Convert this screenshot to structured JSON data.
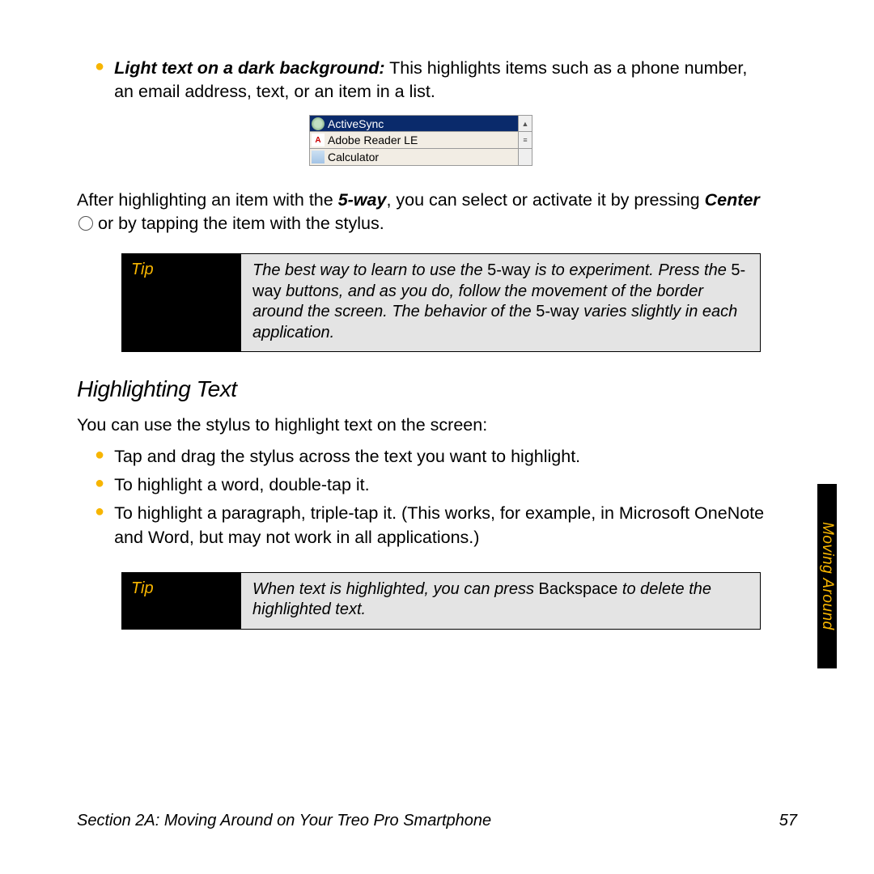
{
  "intro_bullet": {
    "lead_bold": "Light text on a dark background:",
    "rest": " This highlights items such as a phone number, an email address, text, or an item in a list."
  },
  "screenshot": {
    "rows": [
      {
        "label": "ActiveSync"
      },
      {
        "label": "Adobe Reader LE"
      },
      {
        "label": "Calculator"
      }
    ]
  },
  "after_para": {
    "pre": "After highlighting an item with the ",
    "fiveway": "5-way",
    "mid": ", you can select or activate it by pressing ",
    "center": "Center",
    "post": " or by tapping the item with the stylus."
  },
  "tip1": {
    "label": "Tip",
    "t1": "The best way to learn to use the ",
    "b1": "5-way",
    "t2": " is to experiment. Press the ",
    "b2": "5-way",
    "t3": " buttons, and as you do, follow the movement of the border around the screen. The behavior of the ",
    "b3": "5-way",
    "t4": " varies slightly in each application."
  },
  "heading": "Highlighting Text",
  "sub_para": "You can use the stylus to highlight text on the screen:",
  "bullets": [
    "Tap and drag the stylus across the text you want to highlight.",
    "To highlight a word, double-tap it.",
    "To highlight a paragraph, triple-tap it. (This works, for example, in Microsoft OneNote and Word, but may not work in all applications.)"
  ],
  "tip2": {
    "label": "Tip",
    "t1": "When text is highlighted, you can press ",
    "b1": "Backspace",
    "t2": " to delete the highlighted text."
  },
  "side_tab": "Moving Around",
  "footer": {
    "left": "Section 2A: Moving Around on Your Treo Pro Smartphone",
    "page": "57"
  }
}
